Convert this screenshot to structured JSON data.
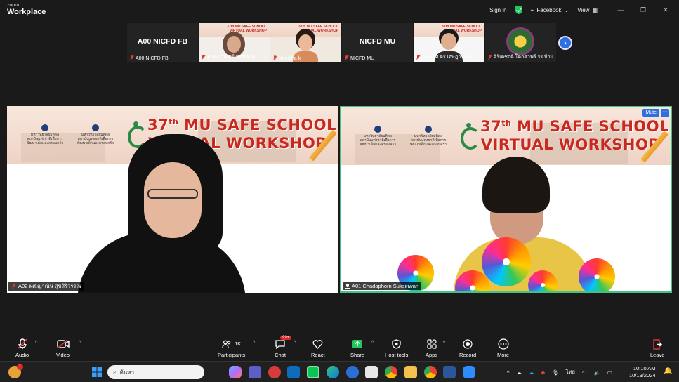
{
  "app": {
    "brand_small": "zoom",
    "brand_large": "Workplace"
  },
  "topbar": {
    "sign_in": "Sign in",
    "facebook": "Facebook",
    "view": "View"
  },
  "gallery": [
    {
      "big": "A00 NICFD FB",
      "caption": "A00 NICFD FB"
    },
    {
      "caption": "A04-ภาณิชย์แพทย์หญิง..."
    },
    {
      "caption": "Konittha k"
    },
    {
      "big": "NICFD MU",
      "caption": "NICFD MU"
    },
    {
      "caption": "A03-ผศ.ดร.เจษฎา แพนง..."
    },
    {
      "caption": "ศิริเดชฤดี โคกคาฟรี รร.บ้าน..."
    }
  ],
  "slide": {
    "uni_name": "มหาวิทยาลัยมหิดล",
    "uni_sub": "สถาบันแห่งชาติเพื่อการพัฒนาเด็กและครอบครัว",
    "ordinal": "37",
    "sup": "th",
    "line1": " MU SAFE SCHOOL",
    "line2": "VIRTUAL WORKSHOP"
  },
  "tiles": {
    "left_caption": "A02-ผศ.ญาณิน สุขสิริวรรณ",
    "right_caption": "A01 Chadaphorn Suksiriwan",
    "mute": "Mute",
    "more": "···"
  },
  "controls": {
    "audio": "Audio",
    "video": "Video",
    "participants": "Participants",
    "participants_count": "1K",
    "chat": "Chat",
    "chat_badge": "99+",
    "react": "React",
    "share": "Share",
    "host_tools": "Host tools",
    "apps": "Apps",
    "record": "Record",
    "more": "More",
    "leave": "Leave"
  },
  "taskbar": {
    "search_placeholder": "ค้นหา",
    "notif_badge": "1",
    "lang": "ไทย",
    "time": "10:10 AM",
    "date": "10/19/2024"
  }
}
